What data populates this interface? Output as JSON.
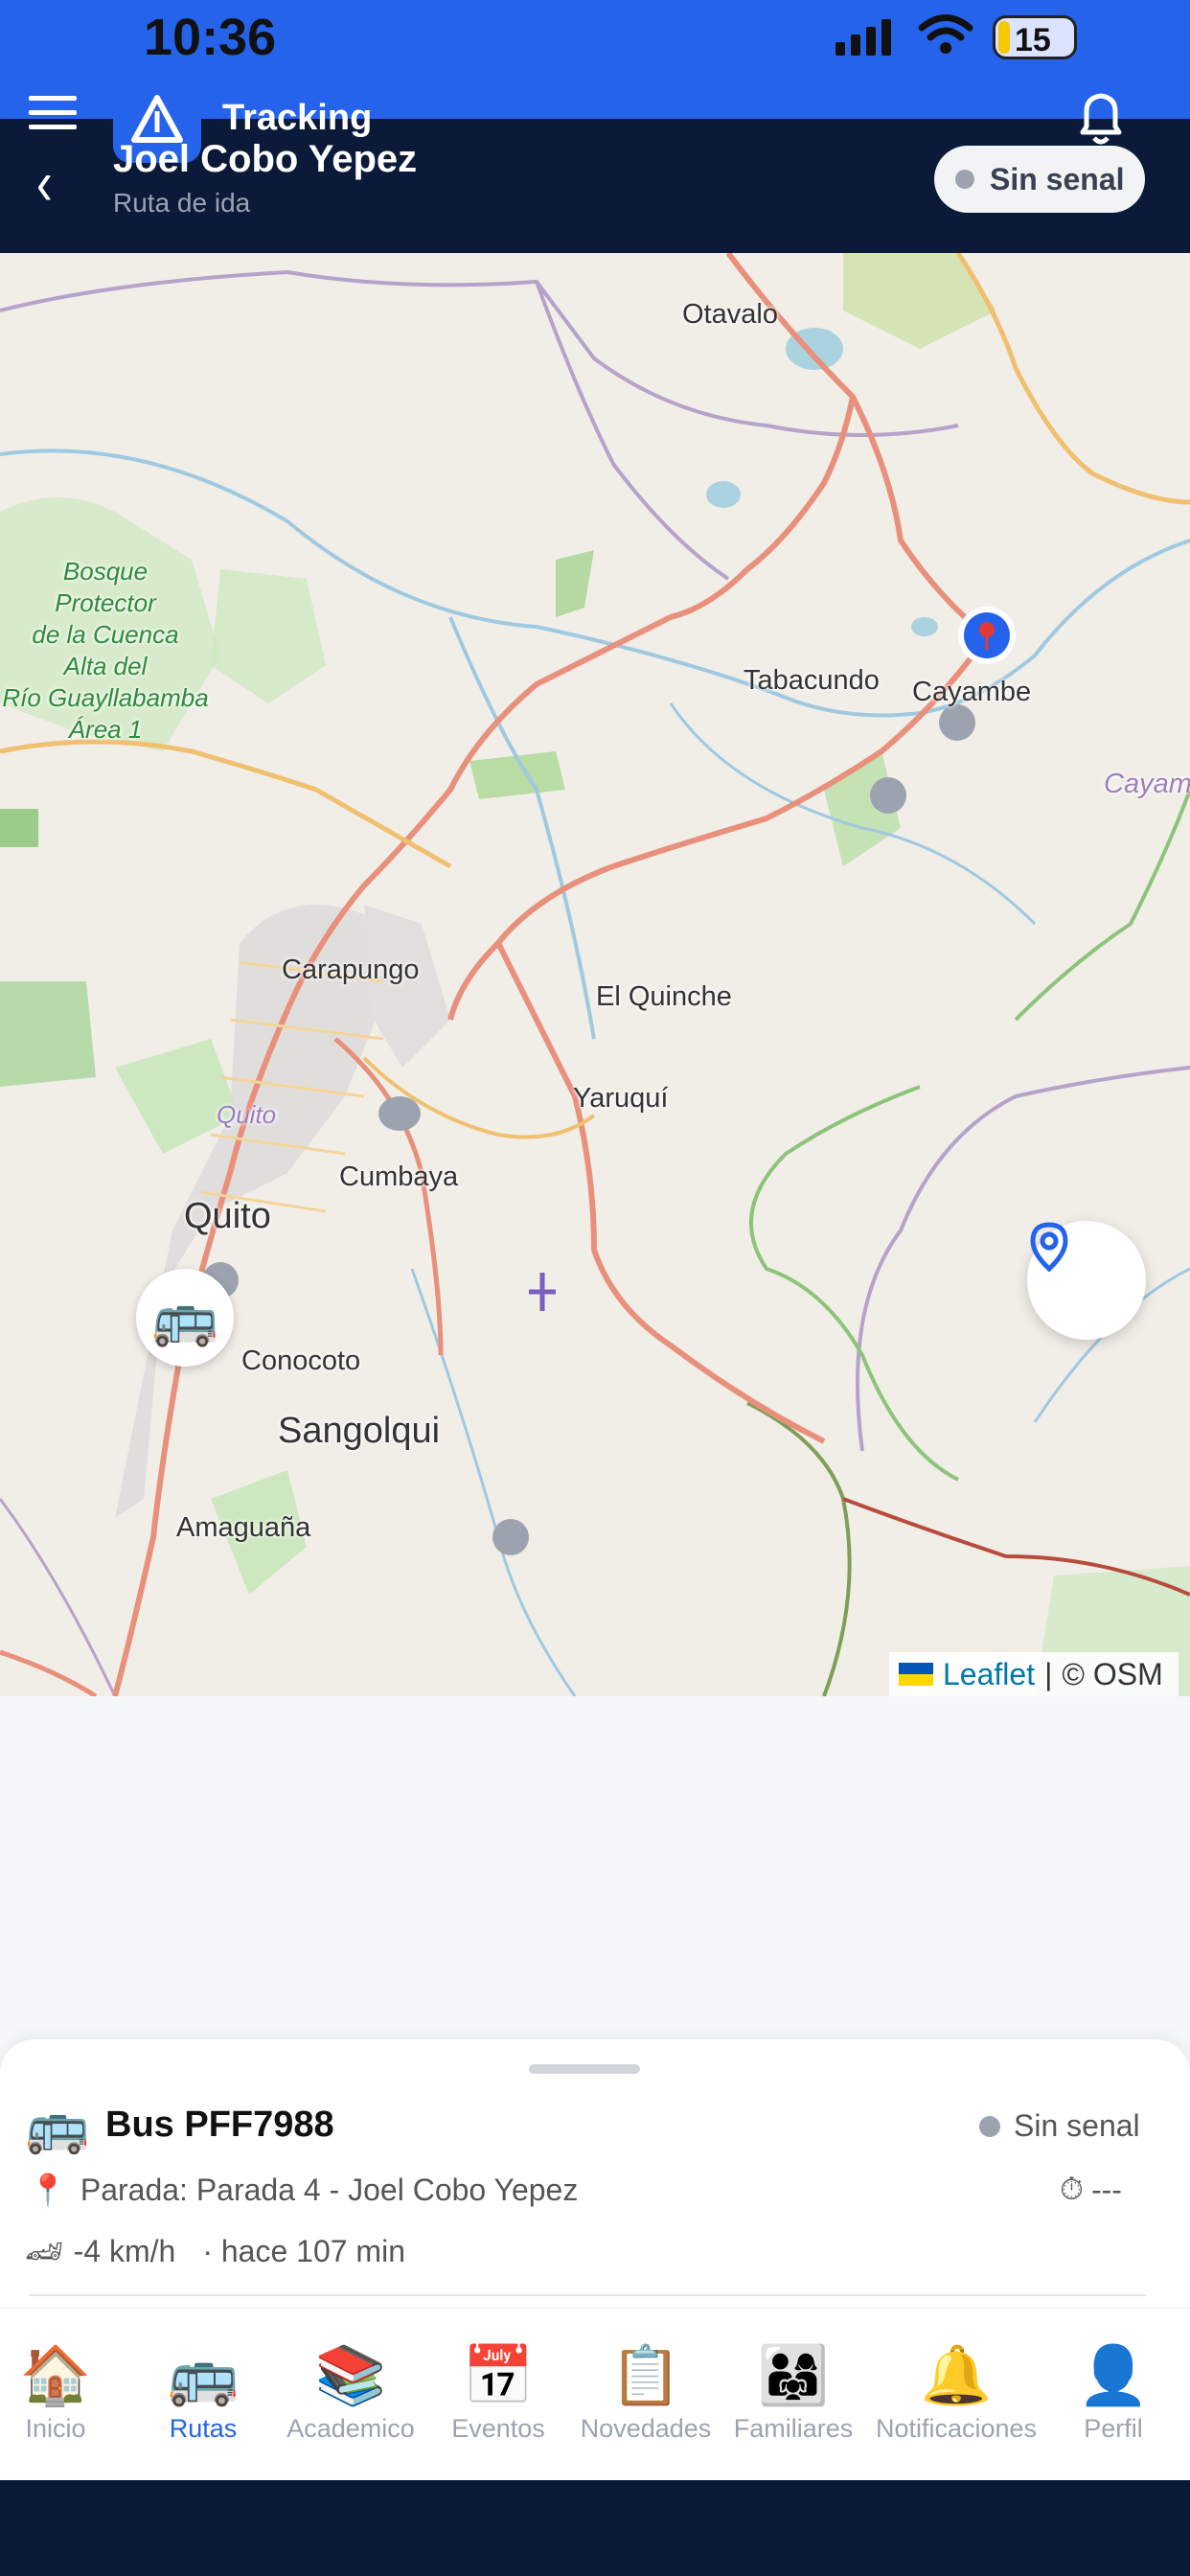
{
  "status_bar": {
    "time": "10:36",
    "battery": "15"
  },
  "header": {
    "app_title": "Tracking",
    "user_name": "Joel Cobo Yepez",
    "route_type": "Ruta de ida",
    "signal_status": "Sin senal"
  },
  "map": {
    "labels": {
      "otavalo": "Otavalo",
      "tabacundo": "Tabacundo",
      "cayambe": "Cayambe",
      "cayambe_right": "Cayam",
      "carapungo": "Carapungo",
      "el_quinche": "El Quinche",
      "yaruqui": "Yaruquí",
      "quito_small": "Quito",
      "quito": "Quito",
      "cumbaya": "Cumbaya",
      "conocoto": "Conocoto",
      "sangolqui": "Sangolqui",
      "amaguana": "Amaguaña",
      "bosque": "Bosque\nProtector\nde la Cuenca\nAlta del\nRío Guayllabamba\nÁrea 1"
    },
    "attribution": {
      "leaflet": "Leaflet",
      "separator": "|",
      "osm": "© OSM"
    }
  },
  "sheet": {
    "bus_label": "Bus PFF7988",
    "status": "Sin senal",
    "stop_text": "Parada: Parada 4 - Joel Cobo Yepez",
    "eta": "---",
    "speed": "-4 km/h",
    "updated": "· hace 107 min"
  },
  "nav": {
    "items": [
      {
        "label": "Inicio",
        "icon": "🏠"
      },
      {
        "label": "Rutas",
        "icon": "🚌"
      },
      {
        "label": "Academico",
        "icon": "📚"
      },
      {
        "label": "Eventos",
        "icon": "📅"
      },
      {
        "label": "Novedades",
        "icon": "📋"
      },
      {
        "label": "Familiares",
        "icon": "👨‍👩‍👧"
      },
      {
        "label": "Notificaciones",
        "icon": "🔔"
      },
      {
        "label": "Perfil",
        "icon": "👤"
      }
    ],
    "active": "Rutas"
  },
  "colors": {
    "accent": "#2563eb",
    "header_bg": "#0b1a38",
    "status_gray": "#9ca3af"
  }
}
